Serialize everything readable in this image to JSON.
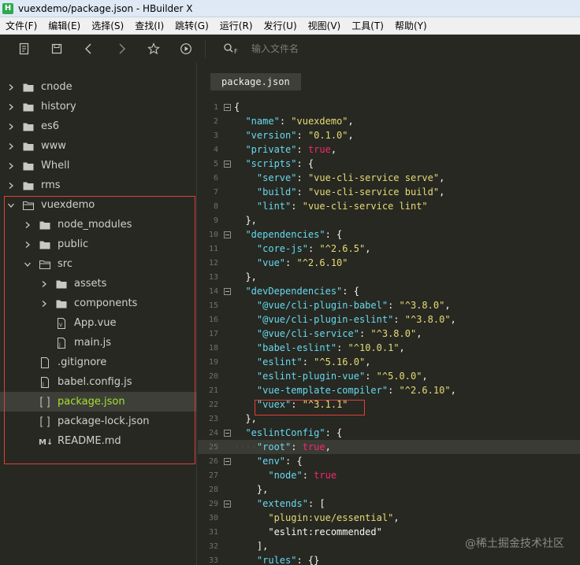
{
  "window": {
    "title": "vuexdemo/package.json - HBuilder X",
    "app_icon": "H"
  },
  "menu": [
    "文件(F)",
    "编辑(E)",
    "选择(S)",
    "查找(I)",
    "跳转(G)",
    "运行(R)",
    "发行(U)",
    "视图(V)",
    "工具(T)",
    "帮助(Y)"
  ],
  "toolbar": {
    "search_placeholder": "输入文件名",
    "search_prefix": "F"
  },
  "tree": [
    {
      "label": "cnode",
      "depth": 0,
      "type": "folder",
      "expanded": false
    },
    {
      "label": "history",
      "depth": 0,
      "type": "folder",
      "expanded": false
    },
    {
      "label": "es6",
      "depth": 0,
      "type": "folder",
      "expanded": false
    },
    {
      "label": "www",
      "depth": 0,
      "type": "folder",
      "expanded": false
    },
    {
      "label": "Whell",
      "depth": 0,
      "type": "folder",
      "expanded": false
    },
    {
      "label": "rms",
      "depth": 0,
      "type": "folder",
      "expanded": false
    },
    {
      "label": "vuexdemo",
      "depth": 0,
      "type": "folder",
      "expanded": true
    },
    {
      "label": "node_modules",
      "depth": 1,
      "type": "folder",
      "expanded": false
    },
    {
      "label": "public",
      "depth": 1,
      "type": "folder",
      "expanded": false
    },
    {
      "label": "src",
      "depth": 1,
      "type": "folder",
      "expanded": true
    },
    {
      "label": "assets",
      "depth": 2,
      "type": "folder",
      "expanded": false
    },
    {
      "label": "components",
      "depth": 2,
      "type": "folder",
      "expanded": false
    },
    {
      "label": "App.vue",
      "depth": 2,
      "type": "vue",
      "expanded": null
    },
    {
      "label": "main.js",
      "depth": 2,
      "type": "js",
      "expanded": null
    },
    {
      "label": ".gitignore",
      "depth": 1,
      "type": "file",
      "expanded": null
    },
    {
      "label": "babel.config.js",
      "depth": 1,
      "type": "js",
      "expanded": null
    },
    {
      "label": "package.json",
      "depth": 1,
      "type": "json",
      "expanded": null,
      "active": true
    },
    {
      "label": "package-lock.json",
      "depth": 1,
      "type": "json",
      "expanded": null
    },
    {
      "label": "README.md",
      "depth": 1,
      "type": "md",
      "expanded": null
    }
  ],
  "editor": {
    "tab": "package.json",
    "lines": [
      {
        "n": "1",
        "fold": true,
        "indent": "",
        "segs": [
          [
            "p",
            "{"
          ]
        ]
      },
      {
        "n": "2",
        "fold": false,
        "indent": "  ",
        "segs": [
          [
            "k",
            "\"name\""
          ],
          [
            "p",
            ": "
          ],
          [
            "s",
            "\"vuexdemo\""
          ],
          [
            "p",
            ","
          ]
        ]
      },
      {
        "n": "3",
        "fold": false,
        "indent": "  ",
        "segs": [
          [
            "k",
            "\"version\""
          ],
          [
            "p",
            ": "
          ],
          [
            "s",
            "\"0.1.0\""
          ],
          [
            "p",
            ","
          ]
        ]
      },
      {
        "n": "4",
        "fold": false,
        "indent": "  ",
        "segs": [
          [
            "k",
            "\"private\""
          ],
          [
            "p",
            ": "
          ],
          [
            "t",
            "true"
          ],
          [
            "p",
            ","
          ]
        ]
      },
      {
        "n": "5",
        "fold": true,
        "indent": "  ",
        "segs": [
          [
            "k",
            "\"scripts\""
          ],
          [
            "p",
            ": {"
          ]
        ]
      },
      {
        "n": "6",
        "fold": false,
        "indent": "    ",
        "segs": [
          [
            "k",
            "\"serve\""
          ],
          [
            "p",
            ": "
          ],
          [
            "s",
            "\"vue-cli-service serve\""
          ],
          [
            "p",
            ","
          ]
        ]
      },
      {
        "n": "7",
        "fold": false,
        "indent": "    ",
        "segs": [
          [
            "k",
            "\"build\""
          ],
          [
            "p",
            ": "
          ],
          [
            "s",
            "\"vue-cli-service build\""
          ],
          [
            "p",
            ","
          ]
        ]
      },
      {
        "n": "8",
        "fold": false,
        "indent": "    ",
        "segs": [
          [
            "k",
            "\"lint\""
          ],
          [
            "p",
            ": "
          ],
          [
            "s",
            "\"vue-cli-service lint\""
          ]
        ]
      },
      {
        "n": "9",
        "fold": false,
        "indent": "  ",
        "segs": [
          [
            "p",
            "},"
          ]
        ]
      },
      {
        "n": "10",
        "fold": true,
        "indent": "  ",
        "segs": [
          [
            "k",
            "\"dependencies\""
          ],
          [
            "p",
            ": {"
          ]
        ]
      },
      {
        "n": "11",
        "fold": false,
        "indent": "    ",
        "segs": [
          [
            "k",
            "\"core-js\""
          ],
          [
            "p",
            ": "
          ],
          [
            "s",
            "\"^2.6.5\""
          ],
          [
            "p",
            ","
          ]
        ]
      },
      {
        "n": "12",
        "fold": false,
        "indent": "    ",
        "segs": [
          [
            "k",
            "\"vue\""
          ],
          [
            "p",
            ": "
          ],
          [
            "s",
            "\"^2.6.10\""
          ]
        ]
      },
      {
        "n": "13",
        "fold": false,
        "indent": "  ",
        "segs": [
          [
            "p",
            "},"
          ]
        ]
      },
      {
        "n": "14",
        "fold": true,
        "indent": "  ",
        "segs": [
          [
            "k",
            "\"devDependencies\""
          ],
          [
            "p",
            ": {"
          ]
        ]
      },
      {
        "n": "15",
        "fold": false,
        "indent": "    ",
        "segs": [
          [
            "k",
            "\"@vue/cli-plugin-babel\""
          ],
          [
            "p",
            ": "
          ],
          [
            "s",
            "\"^3.8.0\""
          ],
          [
            "p",
            ","
          ]
        ]
      },
      {
        "n": "16",
        "fold": false,
        "indent": "    ",
        "segs": [
          [
            "k",
            "\"@vue/cli-plugin-eslint\""
          ],
          [
            "p",
            ": "
          ],
          [
            "s",
            "\"^3.8.0\""
          ],
          [
            "p",
            ","
          ]
        ]
      },
      {
        "n": "17",
        "fold": false,
        "indent": "    ",
        "segs": [
          [
            "k",
            "\"@vue/cli-service\""
          ],
          [
            "p",
            ": "
          ],
          [
            "s",
            "\"^3.8.0\""
          ],
          [
            "p",
            ","
          ]
        ]
      },
      {
        "n": "18",
        "fold": false,
        "indent": "    ",
        "segs": [
          [
            "k",
            "\"babel-eslint\""
          ],
          [
            "p",
            ": "
          ],
          [
            "s",
            "\"^10.0.1\""
          ],
          [
            "p",
            ","
          ]
        ]
      },
      {
        "n": "19",
        "fold": false,
        "indent": "    ",
        "segs": [
          [
            "k",
            "\"eslint\""
          ],
          [
            "p",
            ": "
          ],
          [
            "s",
            "\"^5.16.0\""
          ],
          [
            "p",
            ","
          ]
        ]
      },
      {
        "n": "20",
        "fold": false,
        "indent": "    ",
        "segs": [
          [
            "k",
            "\"eslint-plugin-vue\""
          ],
          [
            "p",
            ": "
          ],
          [
            "s",
            "\"^5.0.0\""
          ],
          [
            "p",
            ","
          ]
        ]
      },
      {
        "n": "21",
        "fold": false,
        "indent": "    ",
        "segs": [
          [
            "k",
            "\"vue-template-compiler\""
          ],
          [
            "p",
            ": "
          ],
          [
            "s",
            "\"^2.6.10\""
          ],
          [
            "p",
            ","
          ]
        ]
      },
      {
        "n": "22",
        "fold": false,
        "indent": "    ",
        "segs": [
          [
            "k",
            "\"vuex\""
          ],
          [
            "p",
            ": "
          ],
          [
            "s",
            "\"^3.1.1\""
          ]
        ]
      },
      {
        "n": "23",
        "fold": false,
        "indent": "  ",
        "segs": [
          [
            "p",
            "},"
          ]
        ]
      },
      {
        "n": "24",
        "fold": true,
        "indent": "  ",
        "segs": [
          [
            "k",
            "\"eslintConfig\""
          ],
          [
            "p",
            ": {"
          ]
        ]
      },
      {
        "n": "25",
        "fold": false,
        "indent": "····",
        "segs": [
          [
            "k",
            "\"root\""
          ],
          [
            "p",
            ": "
          ],
          [
            "t",
            "true"
          ],
          [
            "p",
            ","
          ]
        ],
        "hl": true
      },
      {
        "n": "26",
        "fold": true,
        "indent": "    ",
        "segs": [
          [
            "k",
            "\"env\""
          ],
          [
            "p",
            ": {"
          ]
        ]
      },
      {
        "n": "27",
        "fold": false,
        "indent": "      ",
        "segs": [
          [
            "k",
            "\"node\""
          ],
          [
            "p",
            ": "
          ],
          [
            "t",
            "true"
          ]
        ]
      },
      {
        "n": "28",
        "fold": false,
        "indent": "    ",
        "segs": [
          [
            "p",
            "},"
          ]
        ]
      },
      {
        "n": "29",
        "fold": true,
        "indent": "    ",
        "segs": [
          [
            "k",
            "\"extends\""
          ],
          [
            "p",
            ": ["
          ]
        ]
      },
      {
        "n": "30",
        "fold": false,
        "indent": "      ",
        "segs": [
          [
            "s",
            "\"plugin:vue/essential\""
          ],
          [
            "p",
            ","
          ]
        ]
      },
      {
        "n": "31",
        "fold": false,
        "indent": "      ",
        "segs": [
          [
            "p",
            "\"eslint:recommended\""
          ]
        ]
      },
      {
        "n": "32",
        "fold": false,
        "indent": "    ",
        "segs": [
          [
            "p",
            "],"
          ]
        ]
      },
      {
        "n": "33",
        "fold": false,
        "indent": "    ",
        "segs": [
          [
            "k",
            "\"rules\""
          ],
          [
            "p",
            ": {}"
          ]
        ]
      }
    ]
  },
  "watermark": "@稀土掘金技术社区",
  "colors": {
    "bg": "#272822",
    "key": "#66d9ef",
    "string": "#e6db74",
    "bool": "#f92672",
    "active_file": "#a6e22e",
    "annotation": "#e0403a"
  }
}
